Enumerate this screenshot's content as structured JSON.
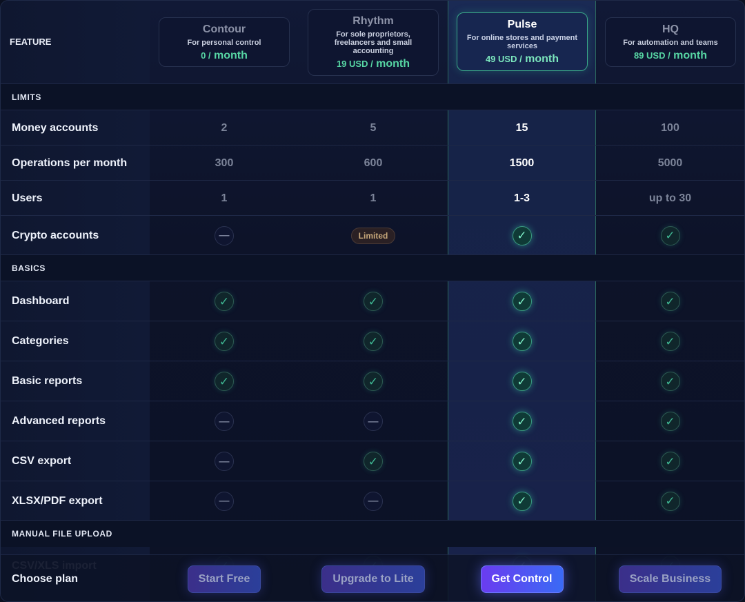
{
  "header": {
    "feature_label": "FEATURE",
    "plans": [
      {
        "name": "Contour",
        "desc": "For personal control",
        "amount": "0 /",
        "period": "month"
      },
      {
        "name": "Rhythm",
        "desc": "For sole proprietors, freelancers and small accounting",
        "amount": "19 USD /",
        "period": "month"
      },
      {
        "name": "Pulse",
        "desc": "For online stores and payment services",
        "amount": "49 USD /",
        "period": "month"
      },
      {
        "name": "HQ",
        "desc": "For automation and teams",
        "amount": "89 USD /",
        "period": "month"
      }
    ]
  },
  "sections": [
    {
      "label": "LIMITS"
    },
    {
      "label": "BASICS"
    },
    {
      "label": "MANUAL FILE UPLOAD"
    }
  ],
  "rows": [
    {
      "label": "Money accounts",
      "values": [
        "2",
        "5",
        "15",
        "100"
      ]
    },
    {
      "label": "Operations per month",
      "values": [
        "300",
        "600",
        "1500",
        "5000"
      ]
    },
    {
      "label": "Users",
      "values": [
        "1",
        "1",
        "1-3",
        "up to 30"
      ]
    },
    {
      "label": "Crypto accounts",
      "values": [
        "dash",
        "Limited",
        "check",
        "check"
      ]
    },
    {
      "label": "Dashboard",
      "values": [
        "check",
        "check",
        "check",
        "check"
      ]
    },
    {
      "label": "Categories",
      "values": [
        "check",
        "check",
        "check",
        "check"
      ]
    },
    {
      "label": "Basic reports",
      "values": [
        "check",
        "check",
        "check",
        "check"
      ]
    },
    {
      "label": "Advanced reports",
      "values": [
        "dash",
        "dash",
        "check",
        "check"
      ]
    },
    {
      "label": "CSV export",
      "values": [
        "dash",
        "check",
        "check",
        "check"
      ]
    },
    {
      "label": "XLSX/PDF export",
      "values": [
        "dash",
        "dash",
        "check",
        "check"
      ]
    }
  ],
  "hidden_row": {
    "label": "CSV/XLS import"
  },
  "footer": {
    "label": "Choose plan",
    "buttons": [
      "Start Free",
      "Upgrade to Lite",
      "Get Control",
      "Scale Business"
    ]
  },
  "icons": {
    "check": "check-icon",
    "dash": "dash-icon"
  },
  "colors": {
    "accent_green": "#57d6a4",
    "button_primary": "#6a3cf0"
  }
}
